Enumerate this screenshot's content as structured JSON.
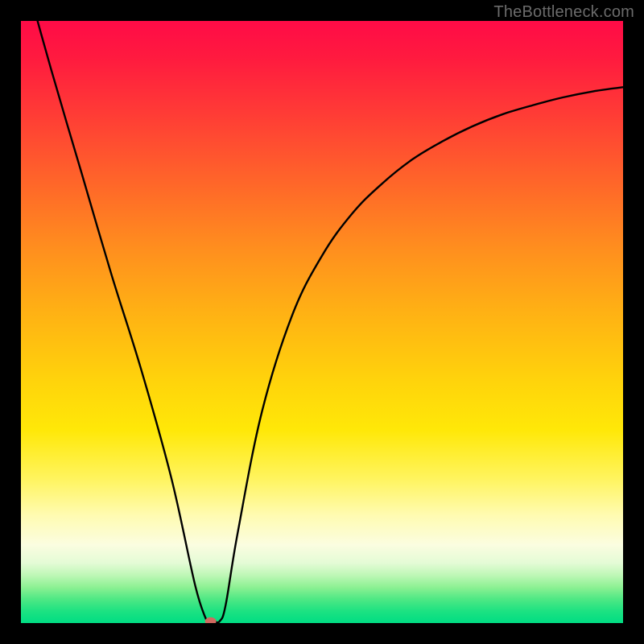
{
  "watermark": "TheBottleneck.com",
  "chart_data": {
    "type": "line",
    "title": "",
    "xlabel": "",
    "ylabel": "",
    "xlim": [
      0,
      100
    ],
    "ylim": [
      0,
      100
    ],
    "grid": false,
    "legend": false,
    "series": [
      {
        "name": "curve",
        "color": "#000000",
        "x": [
          0,
          5,
          10,
          15,
          20,
          25,
          29,
          31,
          32,
          33,
          34,
          36,
          40,
          45,
          50,
          55,
          60,
          65,
          70,
          75,
          80,
          85,
          90,
          95,
          100
        ],
        "y": [
          110,
          92,
          75,
          58,
          42,
          24,
          6,
          0,
          0.3,
          0.3,
          3,
          15,
          35,
          51,
          61,
          68,
          73,
          77,
          80,
          82.5,
          84.5,
          86,
          87.3,
          88.3,
          89
        ]
      }
    ],
    "marker": {
      "x": 31.5,
      "y": 0.3,
      "color": "#d06a60",
      "rx": 7,
      "ry": 5
    },
    "gradient_stops": [
      {
        "pos": 0,
        "color": "#ff0b47"
      },
      {
        "pos": 50,
        "color": "#ffd40b"
      },
      {
        "pos": 90,
        "color": "#e4fbd6"
      },
      {
        "pos": 100,
        "color": "#00dd83"
      }
    ]
  }
}
